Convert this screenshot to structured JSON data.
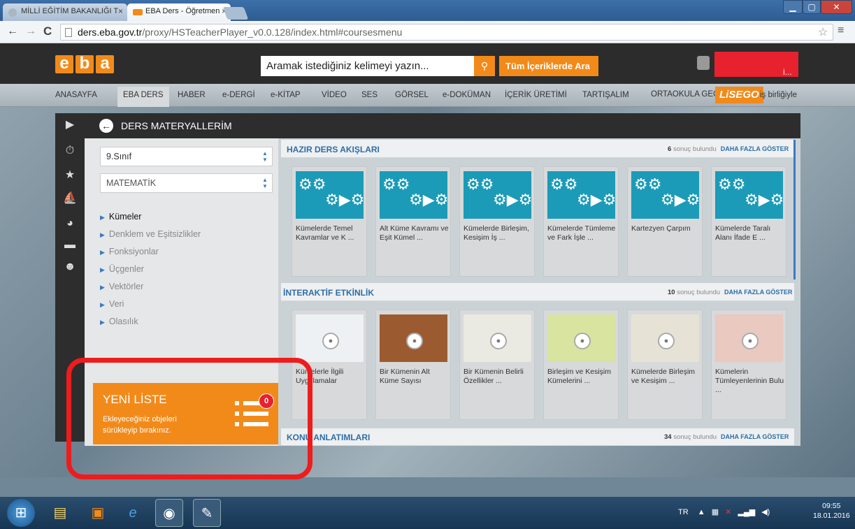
{
  "browser": {
    "tabs": [
      {
        "label": "MİLLİ EĞİTİM BAKANLIĞI T",
        "active": false
      },
      {
        "label": "EBA Ders - Öğretmen",
        "active": true
      }
    ],
    "url_host": "ders.eba.gov.tr",
    "url_path": "/proxy/HSTeacherPlayer_v0.0.128/index.html#coursesmenu",
    "back_icon": "back-arrow-icon",
    "forward_icon": "forward-arrow-icon",
    "reload_icon": "reload-icon",
    "star_icon": "star-icon",
    "menu_icon": "menu-icon"
  },
  "header": {
    "logo_letters": [
      "e",
      "b",
      "a"
    ],
    "search_placeholder": "Aramak istediğiniz kelimeyi yazın...",
    "search_scope": "Tüm İçeriklerde Ara",
    "user_name_suffix": "i..."
  },
  "nav": {
    "items": [
      "ANASAYFA",
      "EBA DERS",
      "HABER",
      "e-DERGİ",
      "e-KİTAP",
      "VİDEO",
      "SES",
      "GÖRSEL",
      "e-DOKÜMAN",
      "İÇERİK ÜRETİMİ",
      "TARTIŞALIM"
    ],
    "active": "EBA DERS",
    "secondary": "ORTAOKULA GEÇ",
    "partner": "LiSEGO",
    "partner_suffix": "iş birliğiyle"
  },
  "app": {
    "title": "DERS MATERYALLERİM",
    "grade_select": "9.Sınıf",
    "subject_select": "MATEMATİK",
    "topics": [
      "Kümeler",
      "Denklem ve Eşitsizlikler",
      "Fonksiyonlar",
      "Üçgenler",
      "Vektörler",
      "Veri",
      "Olasılık"
    ],
    "selected_topic": "Kümeler",
    "new_list": {
      "title": "YENİ LİSTE",
      "text1": "Ekleyeceğiniz objeleri",
      "text2": "sürükleyip bırakınız.",
      "count": "0"
    }
  },
  "sections": [
    {
      "title": "HAZIR DERS AKIŞLARI",
      "count": "6",
      "count_text": "sonuç bulundu",
      "more": "DAHA FAZLA GÖSTER",
      "cards": [
        "Kümelerde Temel Kavramlar ve K ...",
        "Alt Küme Kavramı ve Eşit Kümel ...",
        "Kümelerde Birleşim, Kesişim İş ...",
        "Kümelerde Tümleme ve Fark İşle ...",
        "Kartezyen Çarpım",
        "Kümelerde Taralı Alanı İfade E ..."
      ]
    },
    {
      "title": "İNTERAKTİF ETKİNLİK",
      "count": "10",
      "count_text": "sonuç bulundu",
      "more": "DAHA FAZLA GÖSTER",
      "cards": [
        "Kümelerle İlgili Uygulamalar",
        "Bir Kümenin Alt Küme Sayısı",
        "Bir Kümenin Belirli Özellikler ...",
        "Birleşim ve Kesişim Kümelerini ...",
        "Kümelerde Birleşim ve Kesişim ...",
        "Kümelerin Tümleyenlerinin Bulu ..."
      ]
    },
    {
      "title": "KONU ANLATIMLARI",
      "count": "34",
      "count_text": "sonuç bulundu",
      "more": "DAHA FAZLA GÖSTER"
    }
  ],
  "taskbar": {
    "lang": "TR",
    "time": "09:55",
    "date": "18.01.2016"
  }
}
